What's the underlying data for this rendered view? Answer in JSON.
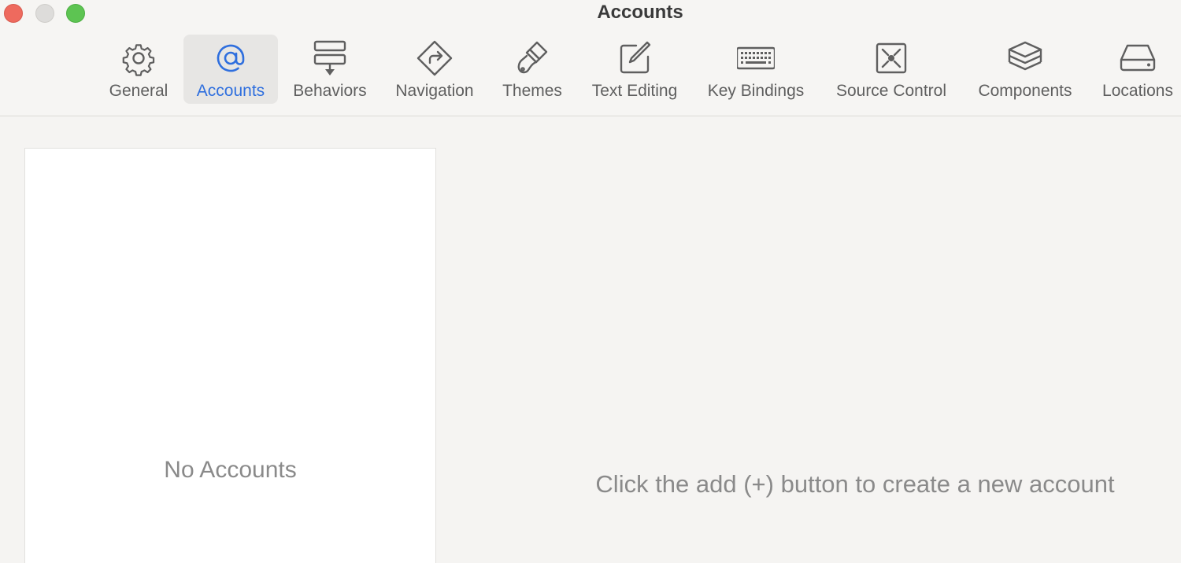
{
  "window": {
    "title": "Accounts"
  },
  "toolbar": {
    "tabs": [
      {
        "label": "General",
        "icon": "gear-icon"
      },
      {
        "label": "Accounts",
        "icon": "at-icon"
      },
      {
        "label": "Behaviors",
        "icon": "behaviors-icon"
      },
      {
        "label": "Navigation",
        "icon": "navigation-icon"
      },
      {
        "label": "Themes",
        "icon": "paintbrush-icon"
      },
      {
        "label": "Text Editing",
        "icon": "pencil-square-icon"
      },
      {
        "label": "Key Bindings",
        "icon": "keyboard-icon"
      },
      {
        "label": "Source Control",
        "icon": "source-control-icon"
      },
      {
        "label": "Components",
        "icon": "layers-icon"
      },
      {
        "label": "Locations",
        "icon": "drive-icon"
      }
    ],
    "active_tab": "Accounts"
  },
  "accounts_list": {
    "empty_text": "No Accounts"
  },
  "detail": {
    "hint_text": "Click the add (+) button to create a new account"
  },
  "colors": {
    "accent": "#2f6fde",
    "close": "#ee6a5e",
    "minimize": "#dddcda",
    "zoom": "#5dc452"
  }
}
